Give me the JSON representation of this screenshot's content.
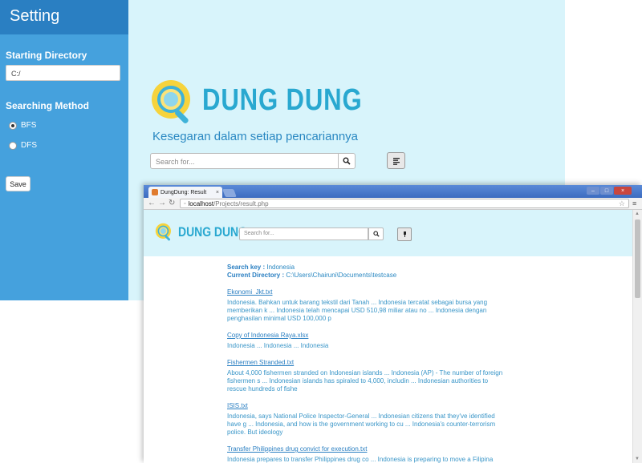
{
  "sidebar": {
    "title": "Setting",
    "starting_directory_heading": "Starting Directory",
    "starting_directory_value": "C:/",
    "searching_method_heading": "Searching Method",
    "methods": [
      {
        "label": "BFS",
        "selected": true
      },
      {
        "label": "DFS",
        "selected": false
      }
    ],
    "save_label": "Save"
  },
  "main_page": {
    "brand": "DUNG DUNG",
    "tagline": "Kesegaran dalam setiap pencariannya",
    "search_placeholder": "Search for..."
  },
  "browser": {
    "tab_title": "DungDung: Result",
    "tab_close": "×",
    "url_host": "localhost",
    "url_path": "/Projects/result.php",
    "brand": "DUNG DUNG",
    "search_placeholder": "Search for...",
    "search_key_label": "Search key :",
    "search_key_value": " Indonesia",
    "current_directory_label": "Current Directory :",
    "current_directory_value": " C:\\Users\\Chairuni\\Documents\\testcase",
    "results": [
      {
        "title": "Ekonomi_Jkt.txt",
        "snippet": "Indonesia. Bahkan untuk barang tekstil dari Tanah ... Indonesia tercatat sebagai bursa yang memberikan k ... Indonesia telah mencapai USD 510,98 miliar atau no ... Indonesia dengan penghasilan minimal USD 100,000 p"
      },
      {
        "title": "Copy of Indonesia Raya.xlsx",
        "snippet": "Indonesia ... Indonesia ... Indonesia"
      },
      {
        "title": "Fishermen Stranded.txt",
        "snippet": "About 4,000 fishermen stranded on Indonesian islands ... Indonesia (AP) - The number of foreign fishermen s ... Indonesian islands has spiraled to 4,000, includin ... Indonesian authorities to rescue hundreds of fishe"
      },
      {
        "title": "ISIS.txt",
        "snippet": "Indonesia, says National Police Inspector-General ... Indonesian citizens that they've identified have g ... Indonesia, and how is the government working to cu ... Indonesia's counter-terrorism police. But ideology"
      },
      {
        "title": "Transfer Philippines drug convict for execution.txt",
        "snippet": "Indonesia prepares to transfer Philippines drug co ... Indonesia is preparing to move a Filipina death ro ... Indonesia has harsh penalties for drug trafficking"
      }
    ]
  },
  "colors": {
    "sidebar_bg": "#45a1dd",
    "sidebar_header_bg": "#2a7fc2",
    "page_bg": "#d8f4fb",
    "brand_text": "#29a8d0",
    "link": "#2a7fc2"
  }
}
